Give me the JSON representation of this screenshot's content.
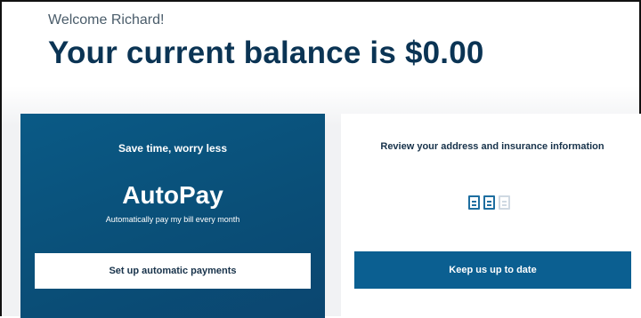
{
  "header": {
    "welcome": "Welcome Richard!",
    "balance_text": "Your current balance is $0.00"
  },
  "autopay_card": {
    "subtitle": "Save time, worry less",
    "title": "AutoPay",
    "description": "Automatically pay my bill every month",
    "button_label": "Set up automatic payments"
  },
  "review_card": {
    "title": "Review your address and insurance information",
    "icons": [
      "document-icon",
      "document-icon",
      "document-icon-faded"
    ],
    "button_label": "Keep us up to date"
  },
  "colors": {
    "heading": "#0b3454",
    "autopay_bg": "#0a4f78",
    "primary_button": "#0b5f91"
  }
}
